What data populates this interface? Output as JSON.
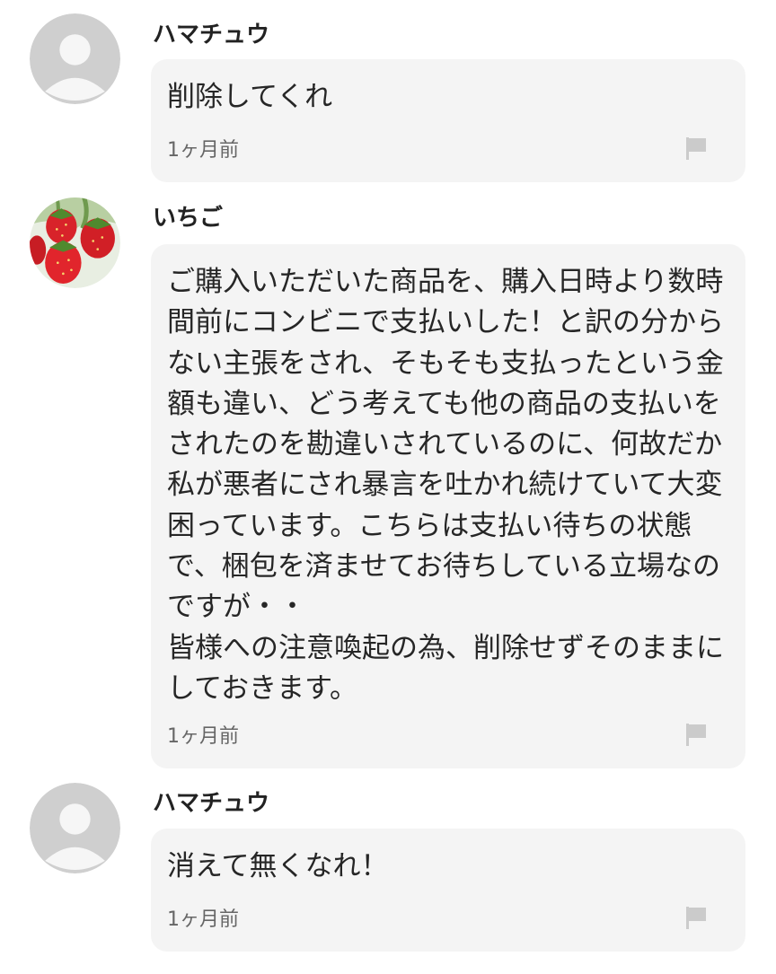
{
  "comments": [
    {
      "user": "ハマチュウ",
      "avatar_icon": "default-user-icon",
      "message": "削除してくれ",
      "time": "1ヶ月前",
      "report_icon": "flag-icon"
    },
    {
      "user": "いちご",
      "avatar_icon": "strawberry-photo",
      "message": "ご購入いただいた商品を、購入日時より数時間前にコンビニで支払いした！と訳の分からない主張をされ、そもそも支払ったという金額も違い、どう考えても他の商品の支払いをされたのを勘違いされているのに、何故だか私が悪者にされ暴言を吐かれ続けていて大変困っています。こちらは支払い待ちの状態\nで、梱包を済ませてお待ちしている立場なのですが・・\n皆様への注意喚起の為、削除せずそのままにしておきます。",
      "time": "1ヶ月前",
      "report_icon": "flag-icon"
    },
    {
      "user": "ハマチュウ",
      "avatar_icon": "default-user-icon",
      "message": "消えて無くなれ！",
      "time": "1ヶ月前",
      "report_icon": "flag-icon"
    }
  ],
  "colors": {
    "bubble_bg": "#f4f4f4",
    "avatar_bg": "#cfcfcf",
    "avatar_fg": "#f6f6f6",
    "flag": "#cbcbcb",
    "meta_text": "#666666"
  }
}
